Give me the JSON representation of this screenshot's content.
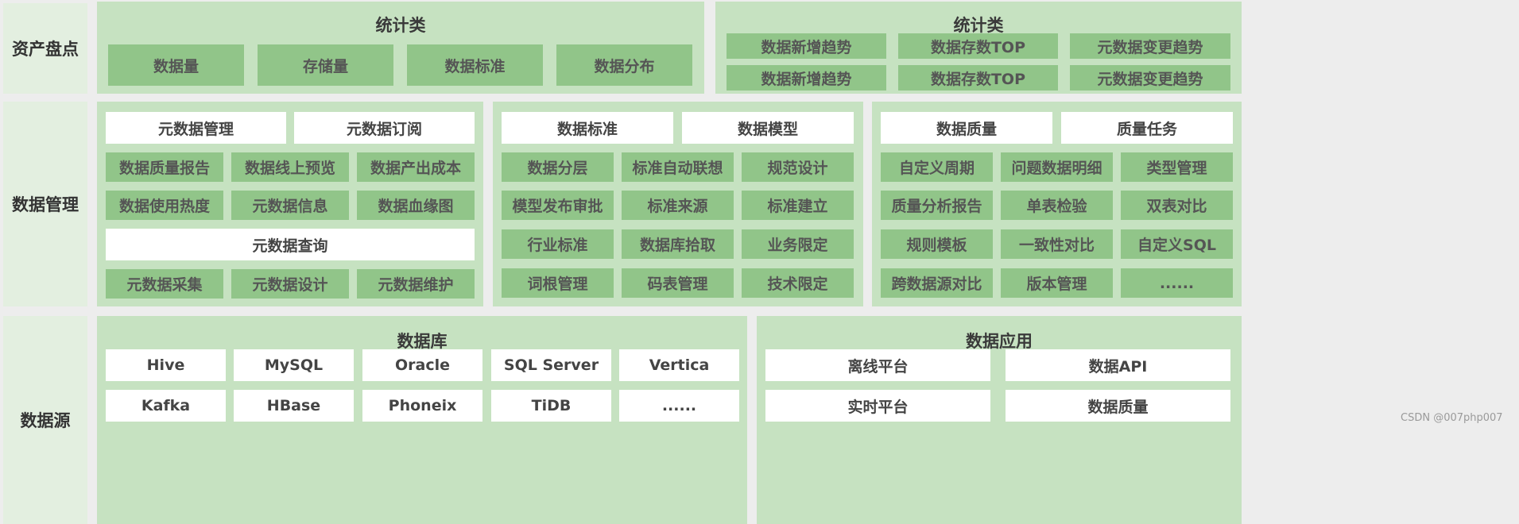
{
  "rows": {
    "asset": "资产盘点",
    "management": "数据管理",
    "source": "数据源"
  },
  "asset": {
    "left": {
      "title": "统计类",
      "items": [
        "数据量",
        "存储量",
        "数据标准",
        "数据分布"
      ]
    },
    "right": {
      "title": "统计类",
      "items": [
        "数据新增趋势",
        "数据存数TOP",
        "元数据变更趋势",
        "数据新增趋势",
        "数据存数TOP",
        "元数据变更趋势"
      ]
    }
  },
  "management": {
    "meta": {
      "headers": [
        "元数据管理",
        "元数据订阅"
      ],
      "row1": [
        "数据质量报告",
        "数据线上预览",
        "数据产出成本"
      ],
      "row2": [
        "数据使用热度",
        "元数据信息",
        "数据血缘图"
      ],
      "query": "元数据查询",
      "row4": [
        "元数据采集",
        "元数据设计",
        "元数据维护"
      ]
    },
    "standard": {
      "headers": [
        "数据标准",
        "数据模型"
      ],
      "items": [
        "数据分层",
        "标准自动联想",
        "规范设计",
        "模型发布审批",
        "标准来源",
        "标准建立",
        "行业标准",
        "数据库拾取",
        "业务限定",
        "词根管理",
        "码表管理",
        "技术限定"
      ]
    },
    "quality": {
      "headers": [
        "数据质量",
        "质量任务"
      ],
      "items": [
        "自定义周期",
        "问题数据明细",
        "类型管理",
        "质量分析报告",
        "单表检验",
        "双表对比",
        "规则模板",
        "一致性对比",
        "自定义SQL",
        "跨数据源对比",
        "版本管理",
        "......"
      ]
    }
  },
  "source": {
    "database": {
      "title": "数据库",
      "items": [
        "Hive",
        "MySQL",
        "Oracle",
        "SQL Server",
        "Vertica",
        "Kafka",
        "HBase",
        "Phoneix",
        "TiDB",
        "......"
      ]
    },
    "application": {
      "title": "数据应用",
      "items": [
        "离线平台",
        "数据API",
        "实时平台",
        "数据质量"
      ]
    }
  },
  "watermark": "CSDN @007php007"
}
